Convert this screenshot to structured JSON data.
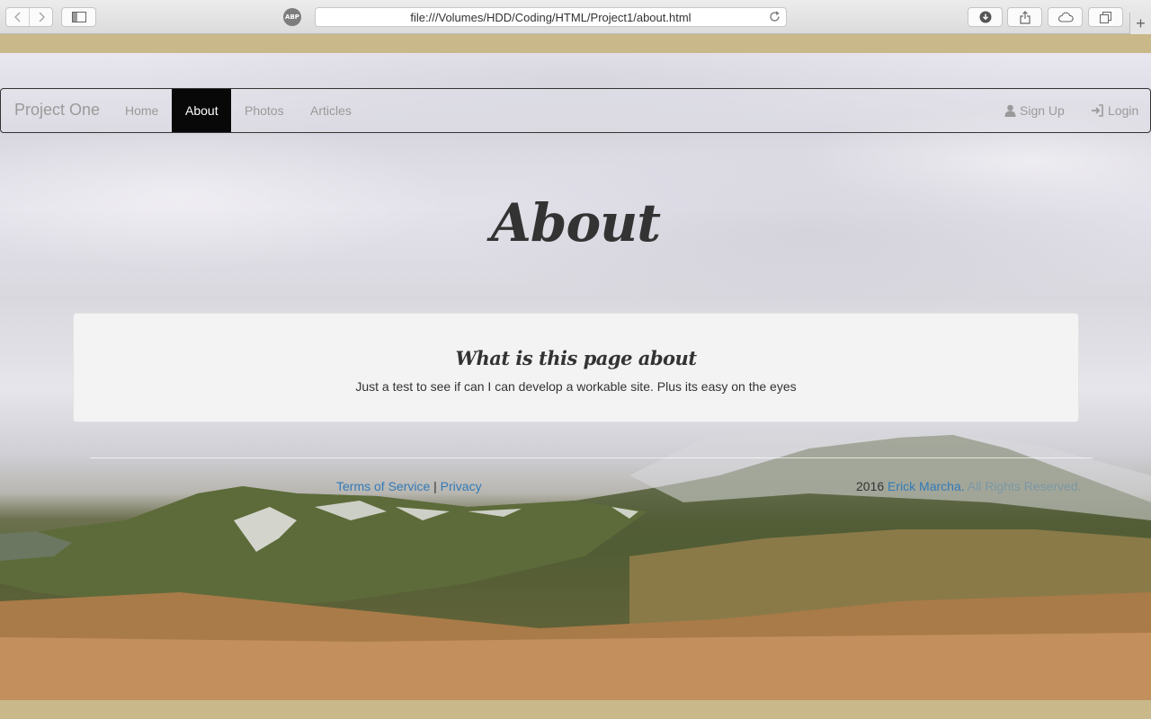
{
  "browser": {
    "url": "file:///Volumes/HDD/Coding/HTML/Project1/about.html",
    "abp_label": "ABP",
    "new_tab_label": "+"
  },
  "navbar": {
    "brand": "Project One",
    "links": [
      "Home",
      "About",
      "Photos",
      "Articles"
    ],
    "active": "About",
    "signup": "Sign Up",
    "login": "Login"
  },
  "page": {
    "title": "About",
    "card_title": "What is this page about",
    "card_text": "Just a test to see if can I can develop a workable site. Plus its easy on the eyes"
  },
  "footer": {
    "terms": "Terms of Service",
    "separator": "|",
    "privacy": "Privacy",
    "year": "2016",
    "author": "Erick Marcha.",
    "rights": "All Rights Reserved."
  },
  "colors": {
    "link": "#337ab7",
    "active_nav_bg": "#080808",
    "card_bg": "#f3f3f3"
  }
}
